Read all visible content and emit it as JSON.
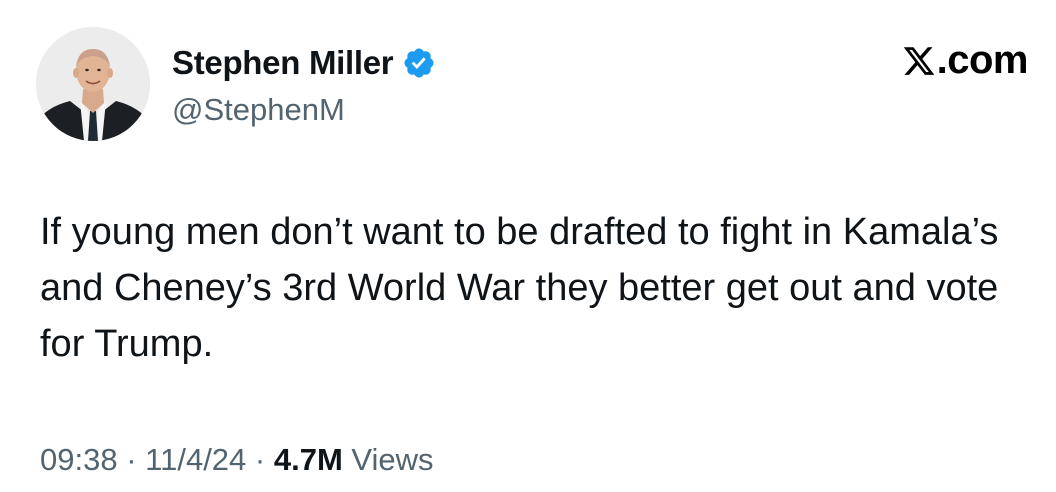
{
  "tweet": {
    "author": {
      "display_name": "Stephen Miller",
      "handle": "@StephenM",
      "verified": true,
      "verified_color": "#1d9bf0"
    },
    "brand": {
      "icon": "x-logo-icon",
      "label": ".com"
    },
    "text": "If young men don’t want to be drafted to fight in Kamala’s and Cheney’s 3rd World War they better get out and vote for Trump.",
    "time": "09:38",
    "separator": "·",
    "date": "11/4/24",
    "views_count": "4.7M",
    "views_label": "Views"
  },
  "colors": {
    "text_primary": "#0f1419",
    "text_secondary": "#536471",
    "background": "#ffffff"
  }
}
